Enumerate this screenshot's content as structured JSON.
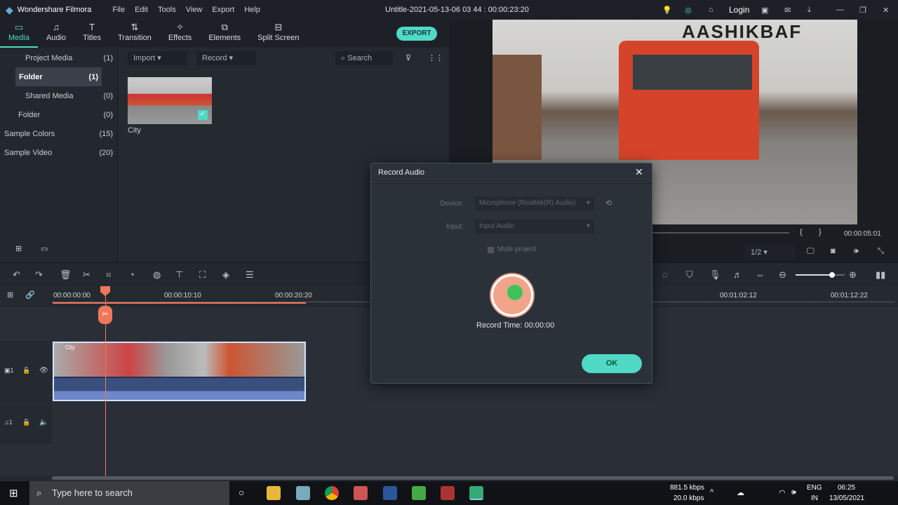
{
  "app": {
    "name": "Wondershare Filmora",
    "menu": [
      "File",
      "Edit",
      "Tools",
      "View",
      "Export",
      "Help"
    ],
    "project_title": "Untitle-2021-05-13-06 03 44 : 00:00:23:20",
    "login": "Login"
  },
  "tabs": [
    {
      "label": "Media",
      "icon": "folder-icon"
    },
    {
      "label": "Audio",
      "icon": "music-note-icon"
    },
    {
      "label": "Titles",
      "icon": "text-icon"
    },
    {
      "label": "Transition",
      "icon": "transition-icon"
    },
    {
      "label": "Effects",
      "icon": "effects-icon"
    },
    {
      "label": "Elements",
      "icon": "elements-icon"
    },
    {
      "label": "Split Screen",
      "icon": "split-screen-icon"
    }
  ],
  "export_label": "EXPORT",
  "library": [
    {
      "label": "Project Media",
      "count": "(1)"
    },
    {
      "label": "Folder",
      "count": "(1)"
    },
    {
      "label": "Shared Media",
      "count": "(0)"
    },
    {
      "label": "Folder",
      "count": "(0)"
    },
    {
      "label": "Sample Colors",
      "count": "(15)"
    },
    {
      "label": "Sample Video",
      "count": "(20)"
    }
  ],
  "media": {
    "import": "Import",
    "record": "Record",
    "search_placeholder": "Search",
    "clip_name": "City"
  },
  "preview": {
    "timecode": "00:00:05:01",
    "quality": "1/2",
    "watermark": "AASHIKBAF"
  },
  "ruler": [
    "00:00:00:00",
    "00:00:10:10",
    "00:00:20:20",
    "00:01:02:12",
    "00:01:12:22"
  ],
  "dialog": {
    "title": "Record Audio",
    "device_label": "Device:",
    "device_value": "Microphone (Realtek(R) Audio)",
    "input_label": "Input:",
    "input_value": "Input Audio",
    "mute_label": "Mute project",
    "record_time": "Record Time: 00:00:00",
    "ok": "OK"
  },
  "timeline": {
    "clip_label": "City",
    "zoom_level": 0.68
  },
  "taskbar": {
    "search_placeholder": "Type here to search",
    "net_down": "881.5 kbps",
    "net_up": "20.0 kbps",
    "lang1": "ENG",
    "lang2": "IN",
    "time": "06:25",
    "date": "13/05/2021"
  },
  "colors": {
    "accent": "#4fd9c6",
    "playhead": "#f2775a",
    "record": "#f0a58a"
  }
}
